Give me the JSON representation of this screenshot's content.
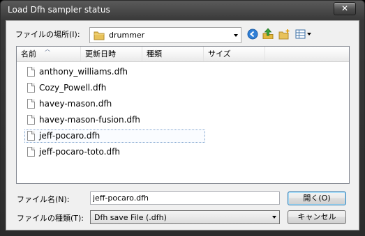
{
  "window": {
    "title": "Load Dfh sampler status",
    "close_glyph": "✕"
  },
  "location": {
    "label": "ファイルの場所(I):",
    "value": "drummer"
  },
  "toolbar": {
    "icons": [
      "back-icon",
      "up-folder-icon",
      "new-folder-icon",
      "view-menu-icon"
    ]
  },
  "columns": [
    "名前",
    "更新日時",
    "種類",
    "サイズ"
  ],
  "files": [
    {
      "name": "anthony_williams.dfh",
      "selected": false
    },
    {
      "name": "Cozy_Powell.dfh",
      "selected": false
    },
    {
      "name": "havey-mason.dfh",
      "selected": false
    },
    {
      "name": "havey-mason-fusion.dfh",
      "selected": false
    },
    {
      "name": "jeff-pocaro.dfh",
      "selected": true
    },
    {
      "name": "jeff-pocaro-toto.dfh",
      "selected": false
    }
  ],
  "filename": {
    "label": "ファイル名(N):",
    "value": "jeff-pocaro.dfh"
  },
  "filetype": {
    "label": "ファイルの種類(T):",
    "value": "Dfh save File (.dfh)"
  },
  "buttons": {
    "open": "開く(O)",
    "cancel": "キャンセル"
  },
  "colors": {
    "title_bar": "#393939",
    "client": "#f0f0f0",
    "selection_border": "#7da2ce",
    "default_button_border": "#3c7fb1"
  }
}
